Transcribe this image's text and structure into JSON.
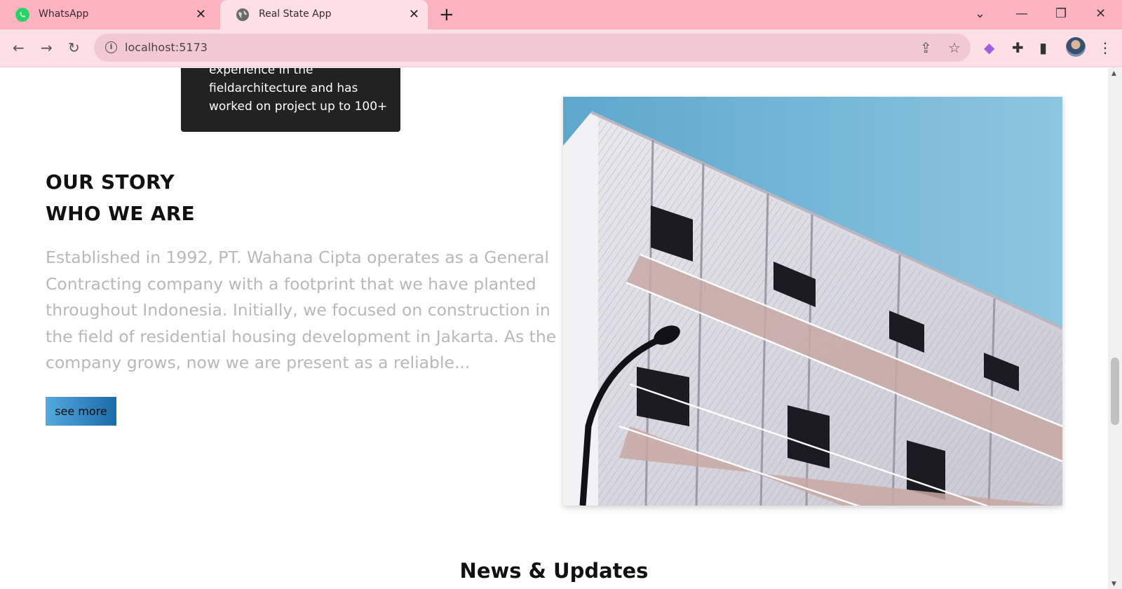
{
  "browser": {
    "tabs": [
      {
        "title": "WhatsApp",
        "icon": "whatsapp-icon",
        "active": false
      },
      {
        "title": "Real State App",
        "icon": "globe-icon",
        "active": true
      }
    ],
    "url": "localhost:5173",
    "accent_color": "#fdb3c0"
  },
  "team_card": {
    "text": "experience in the fieldarchitecture and has worked on project up to 100+"
  },
  "story": {
    "label": "OUR STORY",
    "title": "WHO WE ARE",
    "description": "Established in 1992, PT. Wahana Cipta operates as a General Contracting company with a footprint that we have planted throughout Indonesia. Initially, we focused on construction in the field of residential housing development in Jakarta. As the company grows, now we are present as a reliable...",
    "button_label": "see more"
  },
  "news": {
    "heading": "News & Updates"
  }
}
